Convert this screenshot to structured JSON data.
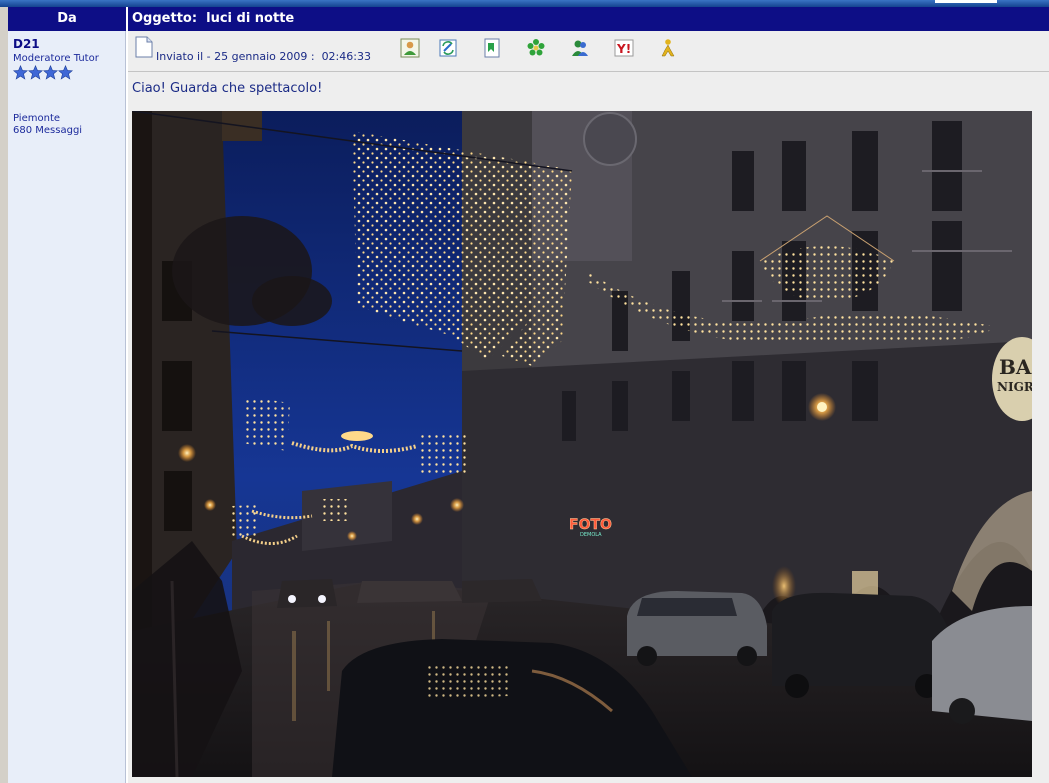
{
  "header": {
    "from_label": "Da",
    "subject_label": "Oggetto:",
    "subject_value": "luci di notte"
  },
  "author": {
    "name": "D21",
    "rank": "Moderatore Tutor",
    "stars": 4,
    "location": "Piemonte",
    "posts": "680 Messaggi"
  },
  "post": {
    "posted_prefix": "Inviato il -",
    "posted_date": "25 gennaio 2009",
    "posted_time": "02:46:33",
    "body": "Ciao! Guarda che spettacolo!",
    "toolbar_icons": [
      "profile-icon",
      "edit-icon",
      "bookmark-icon",
      "icq-icon",
      "msn-icon",
      "yahoo-icon",
      "aim-icon"
    ],
    "photo_sign_text": "FOTO",
    "photo_sign_subtext": "DEMOLA",
    "photo_bar_text": "BAR",
    "photo_bar_subtext": "NIGR"
  },
  "colors": {
    "header_bg": "#0d0e86",
    "header_text": "#ffffff",
    "author_bg": "#e8eef9",
    "post_bg": "#eeeeee",
    "link_text": "#1b2b86",
    "star": "#3f67d6"
  }
}
